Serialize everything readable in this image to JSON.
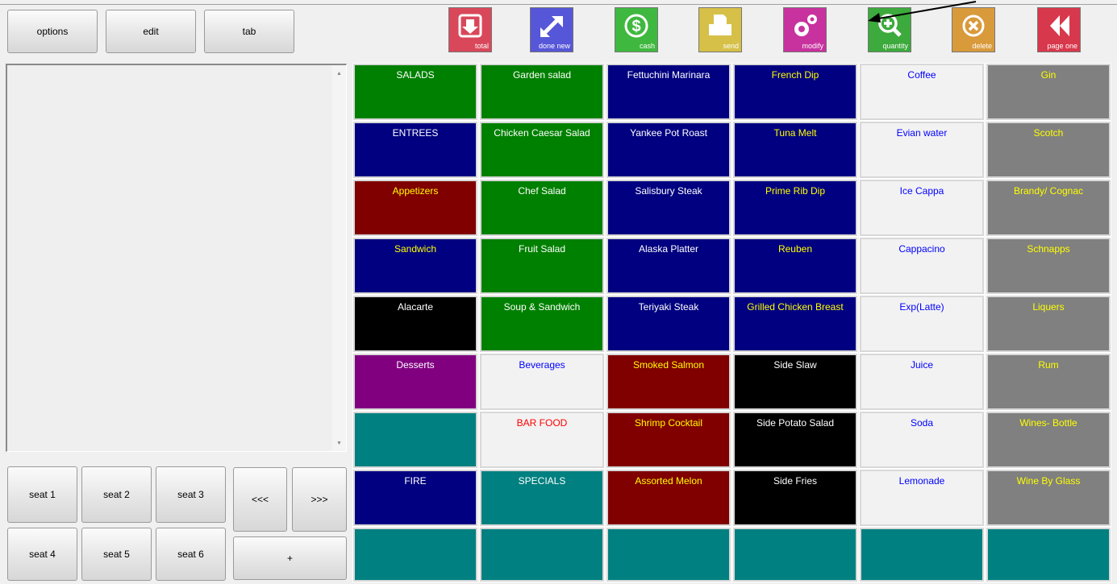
{
  "top_buttons": {
    "options": "options",
    "edit": "edit",
    "tab": "tab"
  },
  "icon_buttons": [
    {
      "label": "total",
      "icon": "download-icon",
      "color": "#d9485a"
    },
    {
      "label": "done new",
      "icon": "expand-icon",
      "color": "#5656d8"
    },
    {
      "label": "cash",
      "icon": "dollar-icon",
      "color": "#3fb83f"
    },
    {
      "label": "send",
      "icon": "printer-icon",
      "color": "#d6c048"
    },
    {
      "label": "modify",
      "icon": "gear-icon",
      "color": "#c8329e"
    },
    {
      "label": "quantity",
      "icon": "zoom-plus-icon",
      "color": "#3caa3c"
    },
    {
      "label": "delete",
      "icon": "cancel-icon",
      "color": "#d99a3c"
    },
    {
      "label": "page one",
      "icon": "rewind-icon",
      "color": "#d8384c"
    }
  ],
  "seat_buttons": [
    "seat  1",
    "seat  2",
    "seat  3",
    "seat  4",
    "seat  5",
    "seat  6"
  ],
  "nav_buttons": {
    "prev": "<<<",
    "next": ">>>",
    "plus": "+"
  },
  "grid": {
    "columns": [
      [
        {
          "label": "SALADS",
          "bg": "#008000",
          "fg": "#ffffff"
        },
        {
          "label": "ENTREES",
          "bg": "#000080",
          "fg": "#ffffff"
        },
        {
          "label": "Appetizers",
          "bg": "#800000",
          "fg": "#ffff00"
        },
        {
          "label": "Sandwich",
          "bg": "#000080",
          "fg": "#ffff00"
        },
        {
          "label": "Alacarte",
          "bg": "#000000",
          "fg": "#ffffff"
        },
        {
          "label": "Desserts",
          "bg": "#800080",
          "fg": "#ffffff"
        },
        {
          "label": "",
          "bg": "#008080",
          "fg": "#ffffff"
        },
        {
          "label": "FIRE",
          "bg": "#000080",
          "fg": "#ffffff"
        },
        {
          "label": "",
          "bg": "#008080",
          "fg": "#ffffff"
        }
      ],
      [
        {
          "label": "Garden salad",
          "bg": "#008000",
          "fg": "#ffffff"
        },
        {
          "label": "Chicken Caesar Salad",
          "bg": "#008000",
          "fg": "#ffffff"
        },
        {
          "label": "Chef Salad",
          "bg": "#008000",
          "fg": "#ffffff"
        },
        {
          "label": "Fruit Salad",
          "bg": "#008000",
          "fg": "#ffffff"
        },
        {
          "label": "Soup & Sandwich",
          "bg": "#008000",
          "fg": "#ffffff"
        },
        {
          "label": "Beverages",
          "bg": "#f2f2f2",
          "fg": "#0000ff"
        },
        {
          "label": "BAR FOOD",
          "bg": "#f2f2f2",
          "fg": "#ff0000"
        },
        {
          "label": "SPECIALS",
          "bg": "#008080",
          "fg": "#ffffff"
        },
        {
          "label": "",
          "bg": "#008080",
          "fg": "#ffffff"
        }
      ],
      [
        {
          "label": "Fettuchini Marinara",
          "bg": "#000080",
          "fg": "#ffffff"
        },
        {
          "label": "Yankee Pot Roast",
          "bg": "#000080",
          "fg": "#ffffff"
        },
        {
          "label": "Salisbury Steak",
          "bg": "#000080",
          "fg": "#ffffff"
        },
        {
          "label": "Alaska Platter",
          "bg": "#000080",
          "fg": "#ffffff"
        },
        {
          "label": "Teriyaki Steak",
          "bg": "#000080",
          "fg": "#ffffff"
        },
        {
          "label": "Smoked Salmon",
          "bg": "#800000",
          "fg": "#ffff00"
        },
        {
          "label": "Shrimp Cocktail",
          "bg": "#800000",
          "fg": "#ffff00"
        },
        {
          "label": "Assorted Melon",
          "bg": "#800000",
          "fg": "#ffff00"
        },
        {
          "label": "",
          "bg": "#008080",
          "fg": "#ffffff"
        }
      ],
      [
        {
          "label": "French Dip",
          "bg": "#000080",
          "fg": "#ffff00"
        },
        {
          "label": "Tuna Melt",
          "bg": "#000080",
          "fg": "#ffff00"
        },
        {
          "label": "Prime Rib Dip",
          "bg": "#000080",
          "fg": "#ffff00"
        },
        {
          "label": "Reuben",
          "bg": "#000080",
          "fg": "#ffff00"
        },
        {
          "label": "Grilled Chicken Breast",
          "bg": "#000080",
          "fg": "#ffff00"
        },
        {
          "label": "Side Slaw",
          "bg": "#000000",
          "fg": "#ffffff"
        },
        {
          "label": "Side Potato Salad",
          "bg": "#000000",
          "fg": "#ffffff"
        },
        {
          "label": "Side Fries",
          "bg": "#000000",
          "fg": "#ffffff"
        },
        {
          "label": "",
          "bg": "#008080",
          "fg": "#ffffff"
        }
      ],
      [
        {
          "label": "Coffee",
          "bg": "#f2f2f2",
          "fg": "#0000ff"
        },
        {
          "label": "Evian water",
          "bg": "#f2f2f2",
          "fg": "#0000ff"
        },
        {
          "label": "Ice Cappa",
          "bg": "#f2f2f2",
          "fg": "#0000ff"
        },
        {
          "label": "Cappacino",
          "bg": "#f2f2f2",
          "fg": "#0000ff"
        },
        {
          "label": "Exp(Latte)",
          "bg": "#f2f2f2",
          "fg": "#0000ff"
        },
        {
          "label": "Juice",
          "bg": "#f2f2f2",
          "fg": "#0000ff"
        },
        {
          "label": "Soda",
          "bg": "#f2f2f2",
          "fg": "#0000ff"
        },
        {
          "label": "Lemonade",
          "bg": "#f2f2f2",
          "fg": "#0000ff"
        },
        {
          "label": "",
          "bg": "#008080",
          "fg": "#ffffff"
        }
      ],
      [
        {
          "label": "Gin",
          "bg": "#808080",
          "fg": "#ffff00"
        },
        {
          "label": "Scotch",
          "bg": "#808080",
          "fg": "#ffff00"
        },
        {
          "label": "Brandy/ Cognac",
          "bg": "#808080",
          "fg": "#ffff00"
        },
        {
          "label": "Schnapps",
          "bg": "#808080",
          "fg": "#ffff00"
        },
        {
          "label": "Liquers",
          "bg": "#808080",
          "fg": "#ffff00"
        },
        {
          "label": "Rum",
          "bg": "#808080",
          "fg": "#ffff00"
        },
        {
          "label": "Wines- Bottle",
          "bg": "#808080",
          "fg": "#ffff00"
        },
        {
          "label": "Wine By Glass",
          "bg": "#808080",
          "fg": "#ffff00"
        },
        {
          "label": "",
          "bg": "#008080",
          "fg": "#ffffff"
        }
      ]
    ]
  }
}
